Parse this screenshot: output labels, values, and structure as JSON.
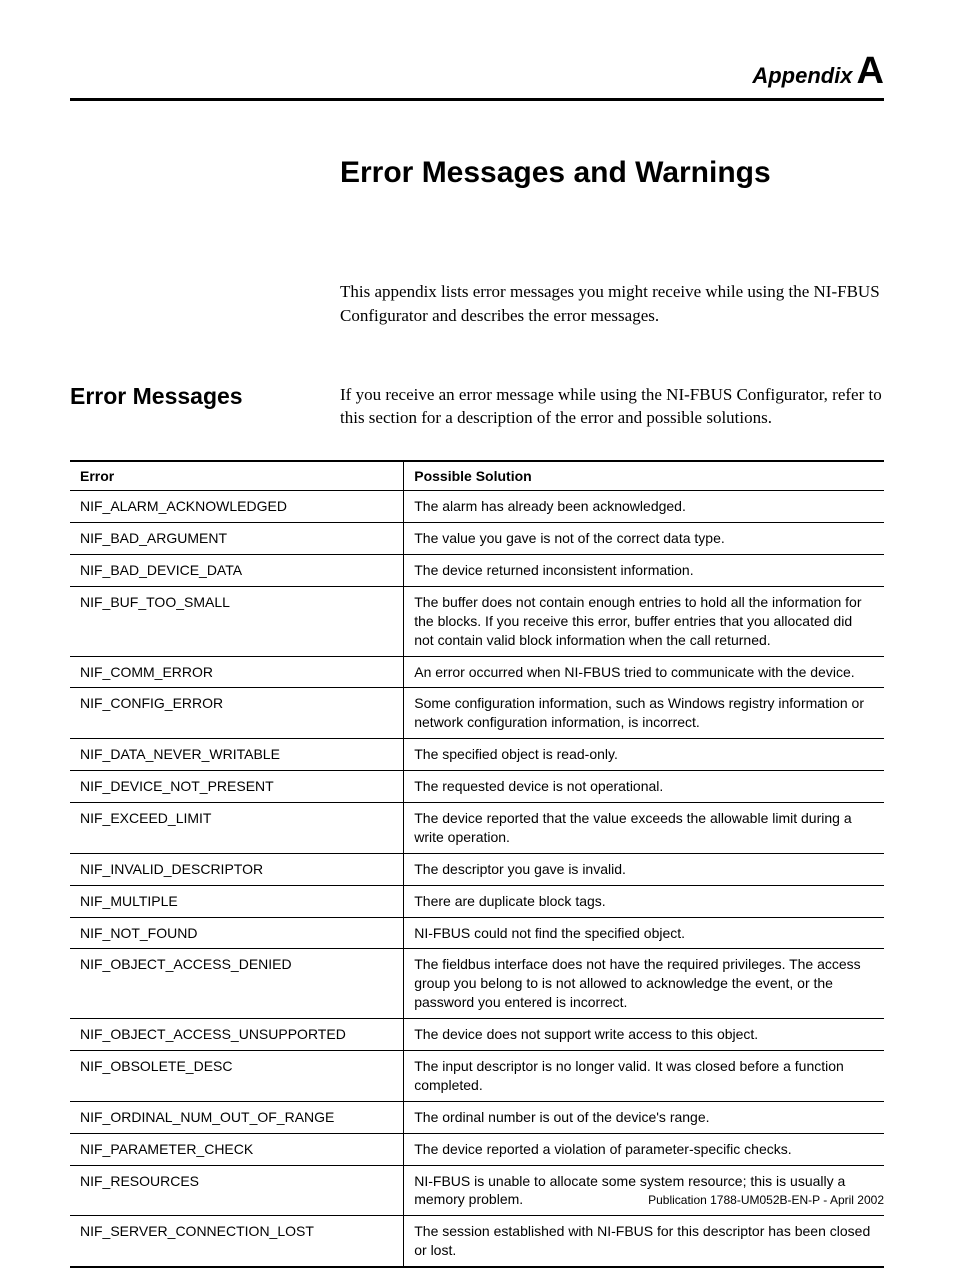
{
  "header": {
    "label": "Appendix",
    "letter": "A"
  },
  "title": "Error Messages and Warnings",
  "intro": "This appendix lists error messages you might receive while using the NI-FBUS Configurator and describes the error messages.",
  "section": {
    "heading": "Error Messages",
    "text": "If you receive an error message while using the NI-FBUS Configurator, refer to this section for a description of the error and possible solutions."
  },
  "table": {
    "headers": {
      "error": "Error",
      "solution": "Possible Solution"
    },
    "rows": [
      {
        "error": "NIF_ALARM_ACKNOWLEDGED",
        "solution": "The alarm has already been acknowledged."
      },
      {
        "error": "NIF_BAD_ARGUMENT",
        "solution": "The value you gave is not of the correct data type."
      },
      {
        "error": "NIF_BAD_DEVICE_DATA",
        "solution": "The device returned inconsistent information."
      },
      {
        "error": "NIF_BUF_TOO_SMALL",
        "solution": "The buffer does not contain enough entries to hold all the information for the blocks. If you receive this error, buffer entries that you allocated did not contain valid block information when the call returned."
      },
      {
        "error": "NIF_COMM_ERROR",
        "solution": "An error occurred when NI-FBUS tried to communicate with the device."
      },
      {
        "error": "NIF_CONFIG_ERROR",
        "solution": "Some configuration information, such as Windows registry information or network configuration information, is incorrect."
      },
      {
        "error": "NIF_DATA_NEVER_WRITABLE",
        "solution": "The specified object is read-only."
      },
      {
        "error": "NIF_DEVICE_NOT_PRESENT",
        "solution": "The requested device is not operational."
      },
      {
        "error": "NIF_EXCEED_LIMIT",
        "solution": "The device reported that the value exceeds the allowable limit during a write operation."
      },
      {
        "error": "NIF_INVALID_DESCRIPTOR",
        "solution": "The descriptor you gave is invalid."
      },
      {
        "error": "NIF_MULTIPLE",
        "solution": "There are duplicate block tags."
      },
      {
        "error": "NIF_NOT_FOUND",
        "solution": "NI-FBUS could not find the specified object."
      },
      {
        "error": "NIF_OBJECT_ACCESS_DENIED",
        "solution": "The fieldbus interface does not have the required privileges. The access group you belong to is not allowed to acknowledge the event, or the password you entered is incorrect."
      },
      {
        "error": "NIF_OBJECT_ACCESS_UNSUPPORTED",
        "solution": "The device does not support write access to this object."
      },
      {
        "error": "NIF_OBSOLETE_DESC",
        "solution": "The input descriptor is no longer valid. It was closed before a function completed."
      },
      {
        "error": "NIF_ORDINAL_NUM_OUT_OF_RANGE",
        "solution": "The ordinal number is out of the device's range."
      },
      {
        "error": "NIF_PARAMETER_CHECK",
        "solution": "The device reported a violation of parameter-specific checks."
      },
      {
        "error": "NIF_RESOURCES",
        "solution": "NI-FBUS is unable to allocate some system resource; this is usually a memory problem."
      },
      {
        "error": "NIF_SERVER_CONNECTION_LOST",
        "solution": "The session established with NI-FBUS for this descriptor has been closed or lost."
      }
    ]
  },
  "footer": "Publication 1788-UM052B-EN-P - April 2002"
}
